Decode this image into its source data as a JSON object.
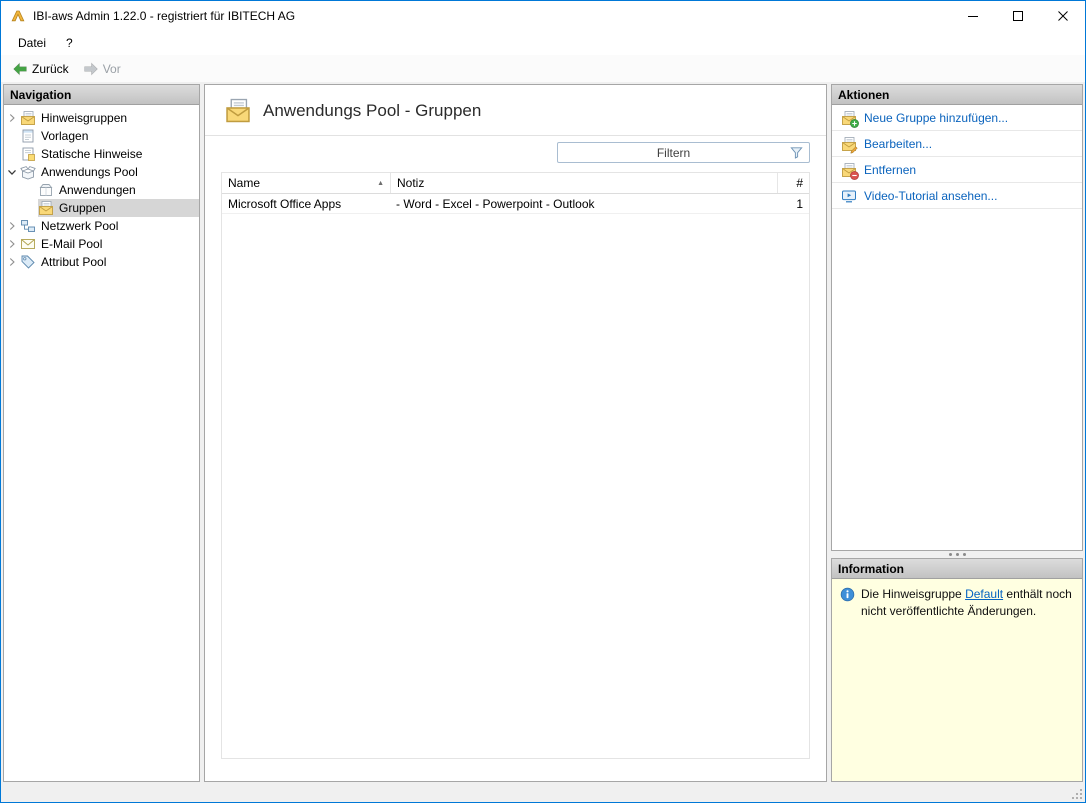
{
  "window": {
    "title": "IBI-aws Admin 1.22.0 - registriert für IBITECH AG",
    "controls": [
      {
        "name": "minimize-icon"
      },
      {
        "name": "maximize-icon"
      },
      {
        "name": "close-icon"
      }
    ]
  },
  "menubar": {
    "items": [
      {
        "label": "Datei"
      },
      {
        "label": "?"
      }
    ]
  },
  "toolbar": {
    "back_label": "Zurück",
    "forward_label": "Vor",
    "back_icon": "back-arrow-icon",
    "forward_icon": "forward-arrow-icon",
    "forward_disabled": true
  },
  "navigation": {
    "header": "Navigation",
    "items": [
      {
        "label": "Hinweisgruppen",
        "icon": "hint-groups-icon",
        "expander": "collapsed",
        "level": 0,
        "selected": false
      },
      {
        "label": "Vorlagen",
        "icon": "templates-icon",
        "expander": "none",
        "level": 0,
        "selected": false
      },
      {
        "label": "Statische Hinweise",
        "icon": "static-hints-icon",
        "expander": "none",
        "level": 0,
        "selected": false
      },
      {
        "label": "Anwendungs Pool",
        "icon": "app-pool-icon",
        "expander": "expanded",
        "level": 0,
        "selected": false
      },
      {
        "label": "Anwendungen",
        "icon": "applications-icon",
        "expander": "none",
        "level": 1,
        "selected": false
      },
      {
        "label": "Gruppen",
        "icon": "groups-icon",
        "expander": "none",
        "level": 1,
        "selected": true
      },
      {
        "label": "Netzwerk Pool",
        "icon": "network-pool-icon",
        "expander": "collapsed",
        "level": 0,
        "selected": false
      },
      {
        "label": "E-Mail Pool",
        "icon": "email-pool-icon",
        "expander": "collapsed",
        "level": 0,
        "selected": false
      },
      {
        "label": "Attribut Pool",
        "icon": "attribute-pool-icon",
        "expander": "collapsed",
        "level": 0,
        "selected": false
      }
    ]
  },
  "content": {
    "title": "Anwendungs Pool - Gruppen",
    "title_icon": "groups-header-icon",
    "filter_placeholder": "Filtern",
    "filter_icon": "filter-funnel-icon",
    "table": {
      "columns": [
        "Name",
        "Notiz",
        "#"
      ],
      "sort": {
        "column": "Name",
        "direction": "asc",
        "indicator": "▲"
      },
      "rows": [
        {
          "name": "Microsoft Office Apps",
          "notiz": "- Word - Excel - Powerpoint - Outlook",
          "count": "1"
        }
      ]
    }
  },
  "actions": {
    "header": "Aktionen",
    "items": [
      {
        "label": "Neue Gruppe hinzufügen...",
        "icon": "add-group-icon"
      },
      {
        "label": "Bearbeiten...",
        "icon": "edit-group-icon"
      },
      {
        "label": "Entfernen",
        "icon": "remove-group-icon"
      },
      {
        "label": "Video-Tutorial ansehen...",
        "icon": "video-tutorial-icon"
      }
    ]
  },
  "information": {
    "header": "Information",
    "icon": "info-icon",
    "message_before": "Die Hinweisgruppe ",
    "message_link": "Default",
    "message_after": " enthält noch nicht veröffentlichte Änderungen."
  },
  "colors": {
    "window_border": "#0078d7",
    "action_link": "#0a63bd",
    "hyperlink": "#0563c1",
    "info_background": "#ffffe1",
    "panel_header_gradient_top": "#dcdcdc",
    "panel_header_gradient_bottom": "#c2c2c2",
    "selection_background": "#d6d6d6",
    "back_arrow_green": "#44a344"
  }
}
